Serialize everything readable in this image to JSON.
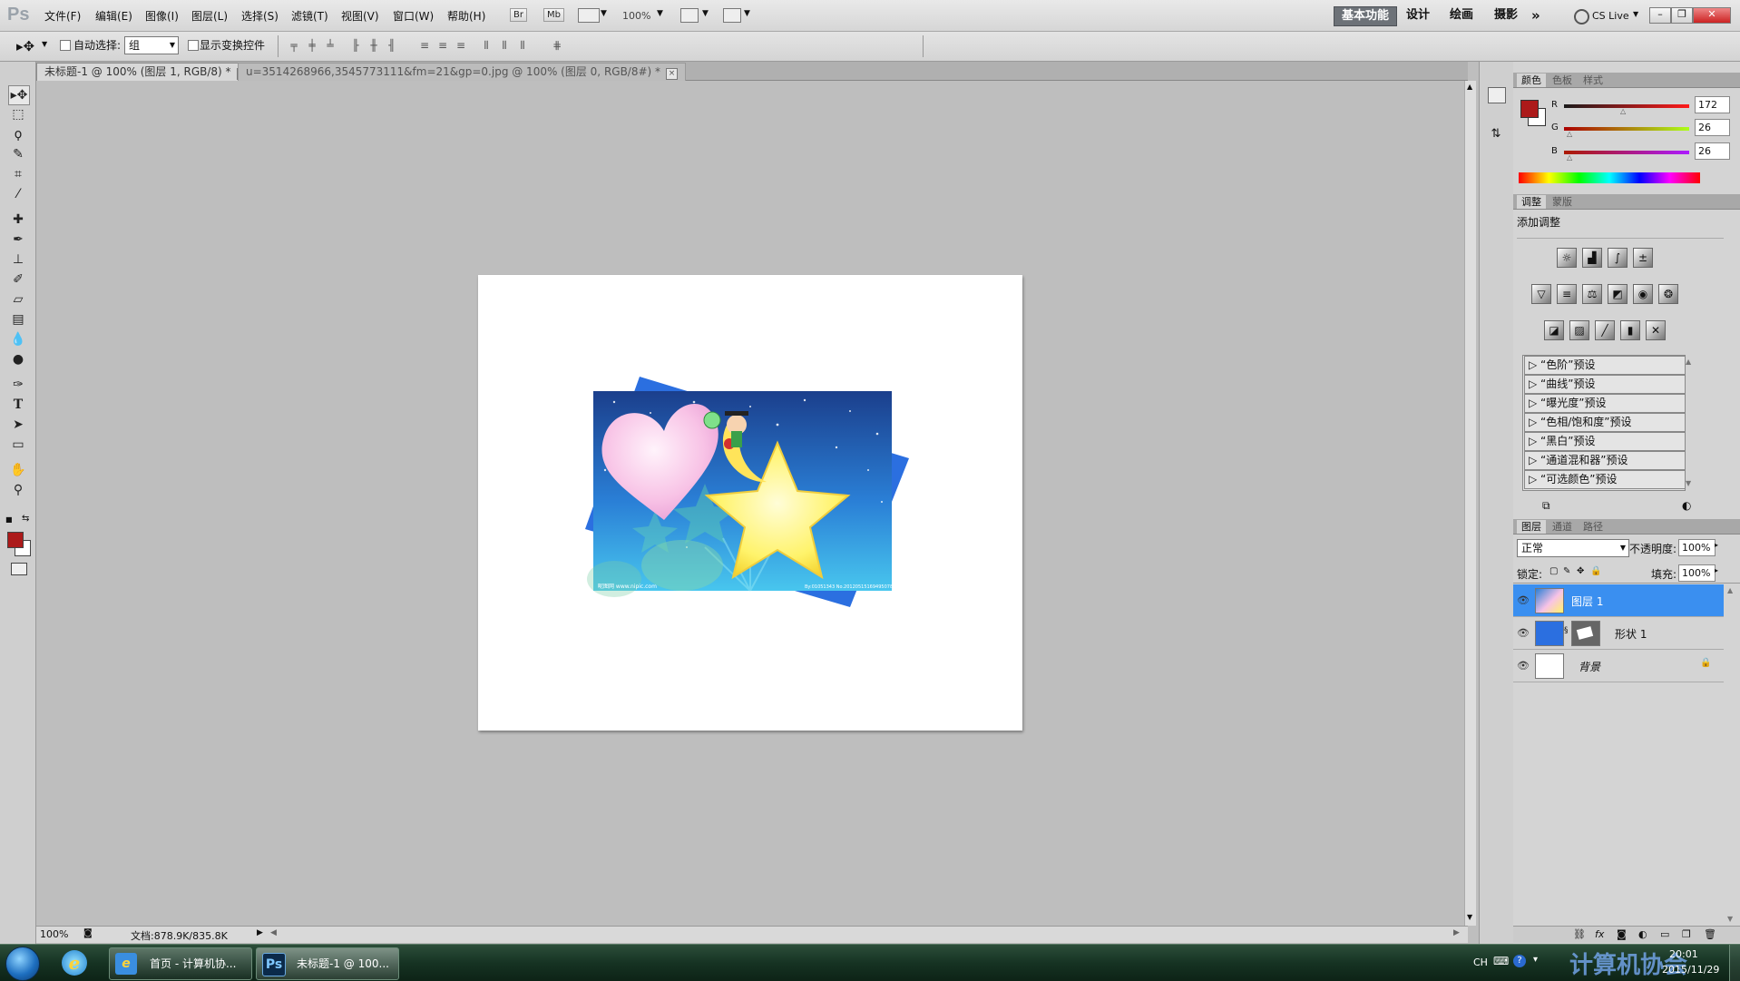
{
  "app": {
    "logo": "Ps",
    "menu": [
      "文件(F)",
      "编辑(E)",
      "图像(I)",
      "图层(L)",
      "选择(S)",
      "滤镜(T)",
      "视图(V)",
      "窗口(W)",
      "帮助(H)"
    ],
    "bridge": "Br",
    "minibridge": "Mb",
    "zoom": "100%",
    "workspaces": [
      "基本功能",
      "设计",
      "绘画",
      "摄影"
    ],
    "more": "»",
    "cslive": "CS Live"
  },
  "options": {
    "auto_select_label": "自动选择:",
    "auto_select_value": "组",
    "show_transform_label": "显示变换控件"
  },
  "tabs": [
    {
      "title": "未标题-1 @ 100% (图层 1, RGB/8) *",
      "close": "×"
    },
    {
      "title": "u=3514268966,3545773111&fm=21&gp=0.jpg @ 100% (图层 0, RGB/8#) *",
      "close": "×"
    }
  ],
  "status": {
    "zoom": "100%",
    "doc": "文档:878.9K/835.8K"
  },
  "color_panel": {
    "tabs": [
      "颜色",
      "色板",
      "样式"
    ],
    "fg_color": "#ac1a1a",
    "r_label": "R",
    "r": "172",
    "g_label": "G",
    "g": "26",
    "b_label": "B",
    "b": "26"
  },
  "adjust_panel": {
    "tabs": [
      "调整",
      "蒙版"
    ],
    "title": "添加调整",
    "presets": [
      "“色阶”预设",
      "“曲线”预设",
      "“曝光度”预设",
      "“色相/饱和度”预设",
      "“黑白”预设",
      "“通道混和器”预设",
      "“可选颜色”预设"
    ]
  },
  "layers_panel": {
    "tabs": [
      "图层",
      "通道",
      "路径"
    ],
    "blend_mode": "正常",
    "opacity_label": "不透明度:",
    "opacity": "100%",
    "lock_label": "锁定:",
    "fill_label": "填充:",
    "fill": "100%",
    "layers": [
      {
        "name": "图层 1",
        "active": true
      },
      {
        "name": "形状 1",
        "active": false
      },
      {
        "name": "背景",
        "active": false
      }
    ]
  },
  "taskbar": {
    "items": [
      {
        "label": "首页 - 计算机协...",
        "icon": "e"
      },
      {
        "label": "未标题-1 @ 100...",
        "icon": "Ps"
      }
    ],
    "lang": "CH",
    "time": "20:01",
    "date": "2015/11/29",
    "watermark": "计算机协会"
  },
  "image": {
    "caption_left": "昵图网 www.nipic.com",
    "caption_right": "By:01051343 No.20120515169495078"
  }
}
